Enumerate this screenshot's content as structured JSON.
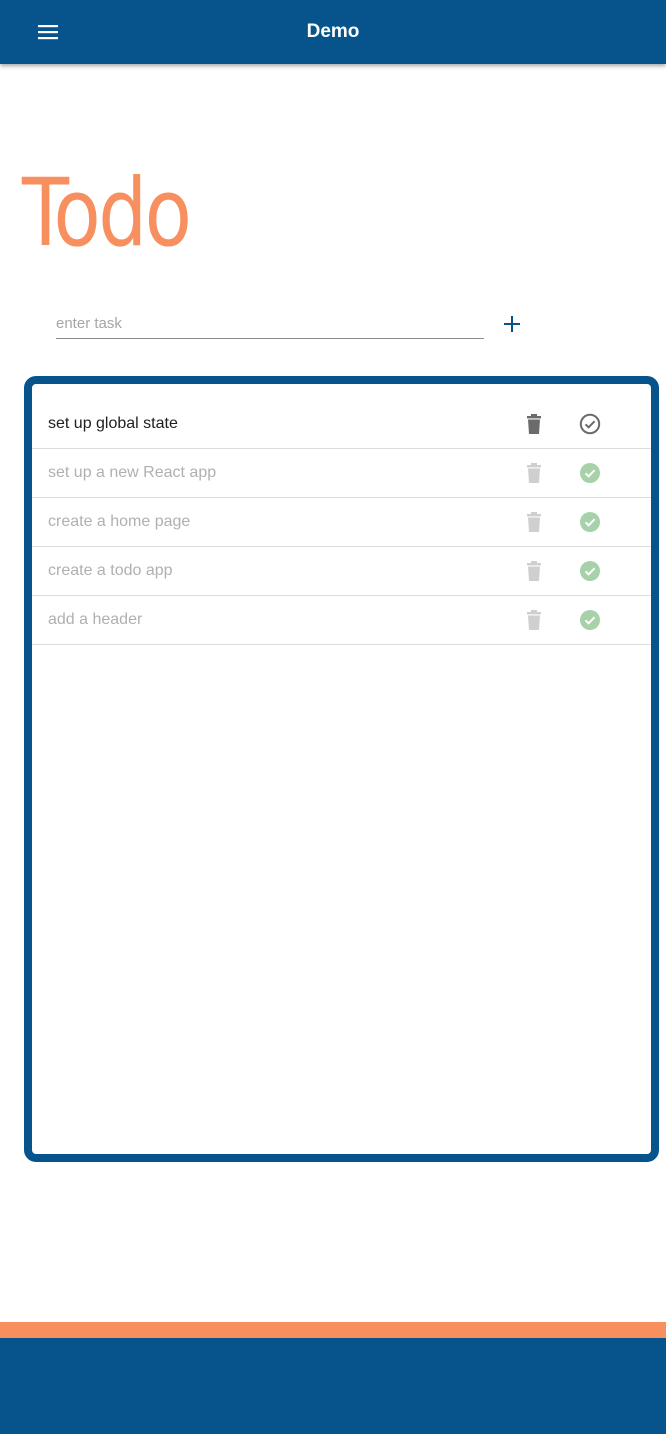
{
  "appbar": {
    "title": "Demo",
    "menu_icon": "hamburger-menu-icon",
    "color": "#07538b"
  },
  "page": {
    "title": "Todo",
    "title_color": "#f78f5e"
  },
  "new_task": {
    "placeholder": "enter task",
    "value": "",
    "add_icon": "plus-icon"
  },
  "todos": [
    {
      "text": "set up global state",
      "completed": false
    },
    {
      "text": "set up a new React app",
      "completed": true
    },
    {
      "text": "create a home page",
      "completed": true
    },
    {
      "text": "create a todo app",
      "completed": true
    },
    {
      "text": "add a header",
      "completed": true
    }
  ],
  "icons": {
    "delete": "trash-icon",
    "complete": "check-circle-icon"
  },
  "colors": {
    "primary": "#07538b",
    "accent": "#f78f5e",
    "done_check": "#a7d1a9",
    "done_text": "#b0b0b0",
    "active_text": "#202020"
  }
}
